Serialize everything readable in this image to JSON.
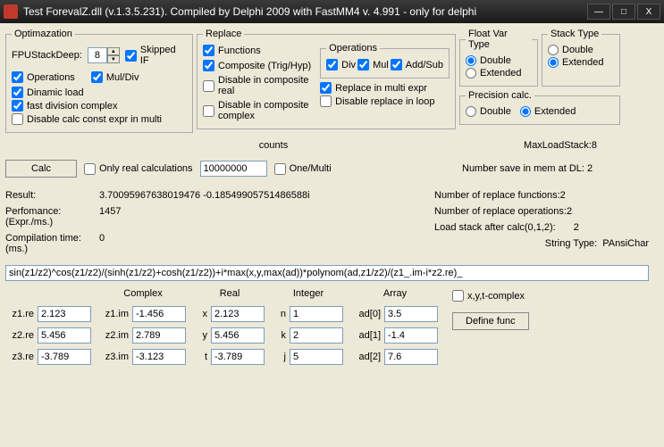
{
  "window": {
    "title": "Test ForevalZ.dll  (v.1.3.5.231).   Compiled by Delphi 2009    with FastMM4 v. 4.991 - only for delphi"
  },
  "optim": {
    "legend": "Optimazation",
    "fpu_label": "FPUStackDeep:",
    "fpu_value": "8",
    "skipped_if": "Skipped IF",
    "operations": "Operations",
    "muldiv": "Mul/Div",
    "dinamic": "Dinamic load",
    "fast_div": "fast division complex",
    "disable_const": "Disable calc const expr in multi"
  },
  "replace": {
    "legend": "Replace",
    "functions": "Functions",
    "composite": "Composite (Trig/Hyp)",
    "dis_real": "Disable in composite real",
    "dis_complex": "Disable in composite complex"
  },
  "ops": {
    "legend": "Operations",
    "div": "Div",
    "mul": "Mul",
    "addsub": "Add/Sub",
    "replace_multi": "Replace in multi expr",
    "disable_loop": "Disable replace in loop"
  },
  "fvt": {
    "legend": "Float Var Type",
    "double": "Double",
    "extended": "Extended"
  },
  "st": {
    "legend": "Stack Type",
    "double": "Double",
    "extended": "Extended"
  },
  "prec": {
    "legend": "Precision calc.",
    "double": "Double",
    "extended": "Extended"
  },
  "calc": {
    "button": "Calc",
    "only_real": "Only real calculations",
    "counts_label": "counts",
    "counts_value": "10000000",
    "one_multi": "One/Multi"
  },
  "stats": {
    "result_lbl": "Result:",
    "result_val": "3.70095967638019476 -0.18549905751486588i",
    "perf_lbl": "Perfomance: (Expr./ms.)",
    "perf_val": "1457",
    "comp_lbl": "Compilation time: (ms.)",
    "comp_val": "0",
    "maxload": "MaxLoadStack:8",
    "numsave": "Number save in mem at DL:  2",
    "numfunc": "Number of replace functions:2",
    "numops": "Number of replace operations:2",
    "loadstack_lbl": "Load stack after calc(0,1,2):",
    "loadstack_val": "2",
    "strtype_lbl": "String Type:",
    "strtype_val": "PAnsiChar"
  },
  "expr": "sin(z1/z2)^cos(z1/z2)/(sinh(z1/z2)+cosh(z1/z2))+i*max(x,y,max(ad))*polynom(ad,z1/z2)/(z1_.im-i*z2.re)_",
  "bottom": {
    "complex_hdr": "Complex",
    "real_hdr": "Real",
    "integer_hdr": "Integer",
    "array_hdr": "Array",
    "z1re_lbl": "z1.re",
    "z1re": "2.123",
    "z1im_lbl": "z1.im",
    "z1im": "-1.456",
    "z2re_lbl": "z2.re",
    "z2re": "5.456",
    "z2im_lbl": "z2.im",
    "z2im": "2.789",
    "z3re_lbl": "z3.re",
    "z3re": "-3.789",
    "z3im_lbl": "z3.im",
    "z3im": "-3.123",
    "x_lbl": "x",
    "x": "2.123",
    "y_lbl": "y",
    "y": "5.456",
    "t_lbl": "t",
    "t": "-3.789",
    "n_lbl": "n",
    "n": "1",
    "k_lbl": "k",
    "k": "2",
    "j_lbl": "j",
    "j": "5",
    "ad0_lbl": "ad[0]",
    "ad0": "3.5",
    "ad1_lbl": "ad[1]",
    "ad1": "-1.4",
    "ad2_lbl": "ad[2]",
    "ad2": "7.6",
    "xyt_complex": "x,y,t-complex",
    "define_func": "Define func"
  }
}
